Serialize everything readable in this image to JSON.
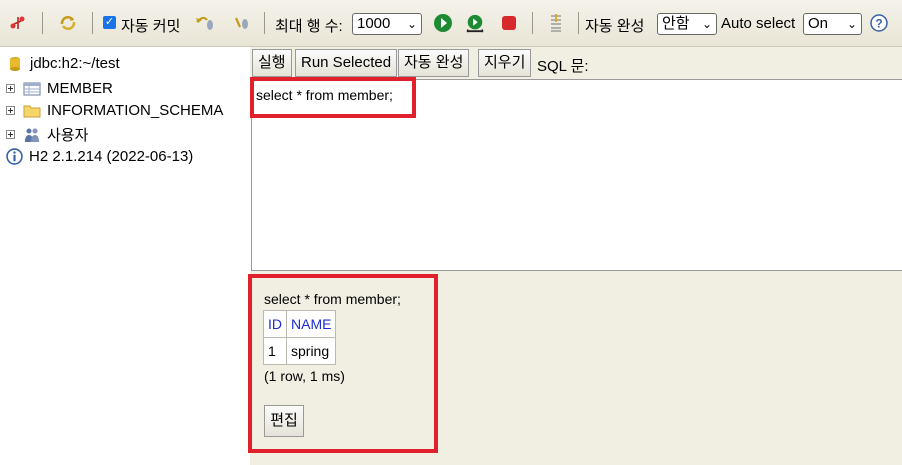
{
  "toolbar": {
    "autocommit_label": "자동 커밋",
    "autocommit_checked": true,
    "max_rows_label": "최대 행 수:",
    "max_rows_value": "1000",
    "autocomplete_label": "자동 완성",
    "autocomplete_value": "안함",
    "autoselect_label": "Auto select",
    "autoselect_value": "On",
    "help_symbol": "?"
  },
  "tree": {
    "connection": "jdbc:h2:~/test",
    "items": [
      {
        "label": "MEMBER",
        "icon": "table-icon"
      },
      {
        "label": "INFORMATION_SCHEMA",
        "icon": "folder-icon"
      },
      {
        "label": "사용자",
        "icon": "users-icon"
      }
    ],
    "version": "H2 2.1.214 (2022-06-13)"
  },
  "command_bar": {
    "run_label": "실행",
    "run_selected_label": "Run Selected",
    "autocomplete_label": "자동 완성",
    "clear_label": "지우기",
    "sql_label": "SQL 문:"
  },
  "editor": {
    "text": "select * from member;"
  },
  "result": {
    "query": "select * from member;",
    "columns": [
      "ID",
      "NAME"
    ],
    "rows": [
      [
        "1",
        "spring"
      ]
    ],
    "info": "(1 row, 1 ms)",
    "edit_label": "편집"
  },
  "colors": {
    "highlight": "#e0202a",
    "header_link": "#1d2bd1",
    "panel_bg": "#f1eee2"
  }
}
